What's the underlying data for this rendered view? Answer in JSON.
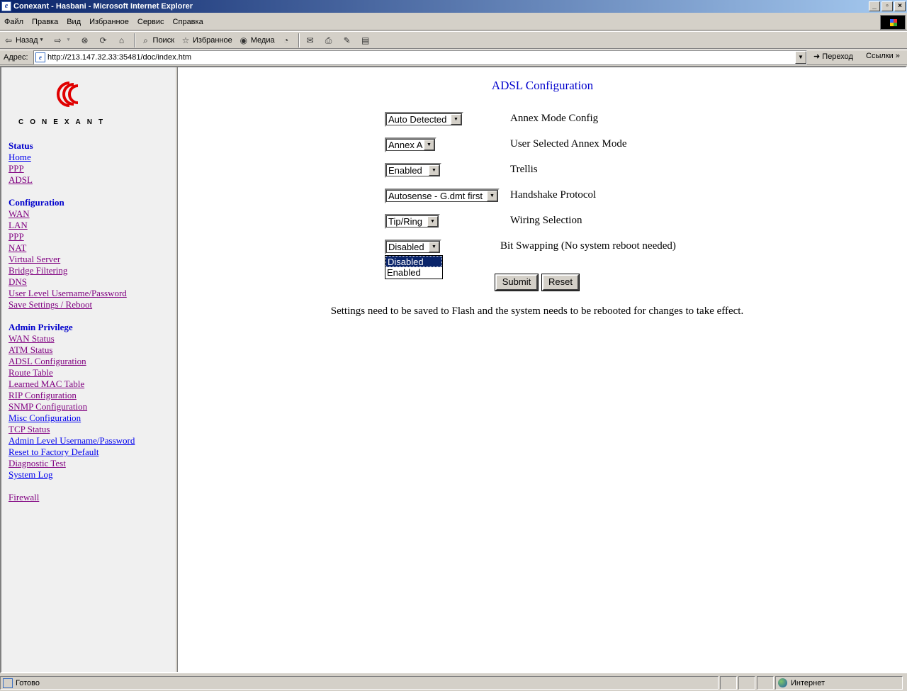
{
  "window": {
    "title": "Conexant - Hasbani - Microsoft Internet Explorer"
  },
  "menu": [
    "Файл",
    "Правка",
    "Вид",
    "Избранное",
    "Сервис",
    "Справка"
  ],
  "toolbar": {
    "back": "Назад",
    "search": "Поиск",
    "favorites": "Избранное",
    "media": "Медиа"
  },
  "address": {
    "label": "Адрес:",
    "url": "http://213.147.32.33:35481/doc/index.htm",
    "go": "Переход",
    "links": "Ссылки"
  },
  "sidebar": {
    "logo_text": "CONEXANT",
    "sections": [
      {
        "heading": "Status",
        "items": [
          "Home",
          "PPP",
          "ADSL"
        ]
      },
      {
        "heading": "Configuration",
        "items": [
          "WAN",
          "LAN",
          "PPP",
          "NAT",
          "Virtual Server",
          "Bridge Filtering",
          "DNS",
          "User Level Username/Password",
          "Save Settings / Reboot"
        ]
      },
      {
        "heading": "Admin Privilege",
        "items": [
          "WAN Status",
          "ATM Status",
          "ADSL Configuration",
          "Route Table",
          "Learned MAC Table",
          "RIP Configuration",
          "SNMP Configuration",
          "Misc Configuration",
          "TCP Status",
          "Admin Level Username/Password",
          "Reset to Factory Default",
          "Diagnostic Test",
          "System Log"
        ]
      },
      {
        "heading": "",
        "items": [
          "Firewall"
        ]
      }
    ]
  },
  "main": {
    "title": "ADSL Configuration",
    "fields": [
      {
        "value": "Auto Detected",
        "label": "Annex Mode Config"
      },
      {
        "value": "Annex A",
        "label": "User Selected Annex Mode"
      },
      {
        "value": "Enabled",
        "label": "Trellis"
      },
      {
        "value": "Autosense - G.dmt first",
        "label": "Handshake Protocol"
      },
      {
        "value": "Tip/Ring",
        "label": "Wiring Selection"
      },
      {
        "value": "Disabled",
        "label": "Bit Swapping (No system reboot needed)"
      }
    ],
    "dropdown_options": [
      "Disabled",
      "Enabled"
    ],
    "submit": "Submit",
    "reset": "Reset",
    "note": "Settings need to be saved to Flash and the system needs to be rebooted for changes to take effect."
  },
  "status": {
    "text": "Готово",
    "zone": "Интернет"
  }
}
